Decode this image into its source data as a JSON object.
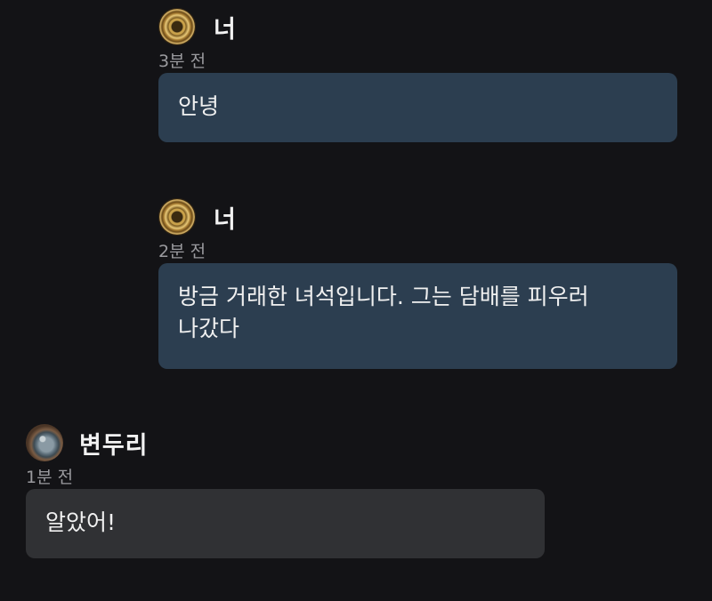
{
  "messages": [
    {
      "sender": "너",
      "time": "3분 전",
      "text": "안녕",
      "avatar": "gold-coin-avatar",
      "bubble_color": "#2c3e50"
    },
    {
      "sender": "너",
      "time": "2분 전",
      "text": "방금 거래한 녀석입니다. 그는 담배를 피우러\n나갔다",
      "avatar": "gold-coin-avatar",
      "bubble_color": "#2c3e50"
    },
    {
      "sender": "변두리",
      "time": "1분 전",
      "text": "알았어!",
      "avatar": "stone-orb-avatar",
      "bubble_color": "#303134"
    }
  ],
  "colors": {
    "background": "#131316",
    "sender_text": "#f2f2f2",
    "timestamp_text": "#9a9a9e"
  }
}
